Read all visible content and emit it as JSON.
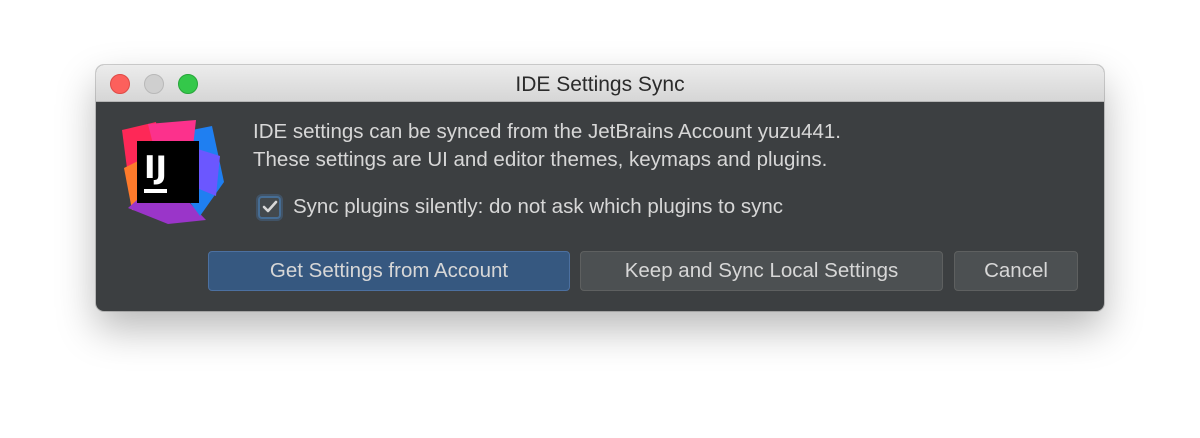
{
  "window": {
    "title": "IDE Settings Sync"
  },
  "titlebar": {
    "buttons": [
      "close",
      "minimize",
      "zoom"
    ]
  },
  "logo": {
    "text": "IJ",
    "icon": "intellij-idea-logo-icon"
  },
  "message": {
    "line1": "IDE settings can be synced from the JetBrains Account yuzu441.",
    "line2": "These settings are UI and editor themes, keymaps and plugins."
  },
  "checkbox": {
    "label": "Sync plugins silently: do not ask which plugins to sync",
    "checked": true
  },
  "buttons": {
    "get_settings": "Get Settings from Account",
    "keep_sync": "Keep and Sync Local Settings",
    "cancel": "Cancel"
  },
  "colors": {
    "dialog_bg": "#3c3f41",
    "primary_button": "#365880",
    "secondary_button": "#4c5052",
    "text": "#d7d7d7",
    "close": "#fc605c",
    "minimize": "#cfcfcf",
    "zoom": "#34c84a"
  }
}
